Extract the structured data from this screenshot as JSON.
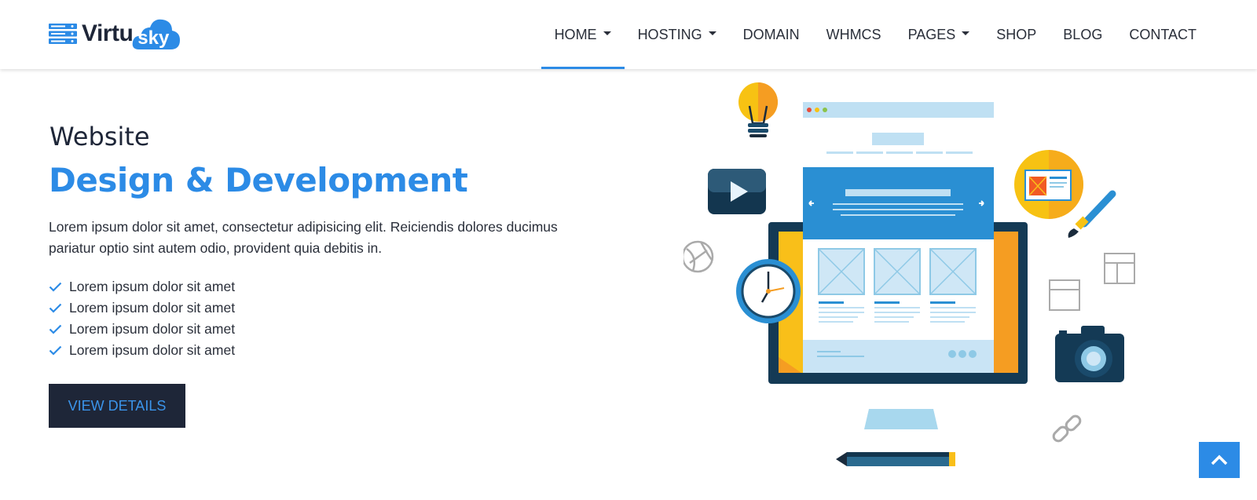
{
  "brand": {
    "name_prefix": "Virtu",
    "name_suffix": "sky",
    "accent_color": "#2c8be6",
    "dark_color": "#1e2638"
  },
  "nav": {
    "items": [
      {
        "label": "HOME",
        "has_dropdown": true,
        "active": true
      },
      {
        "label": "HOSTING",
        "has_dropdown": true,
        "active": false
      },
      {
        "label": "DOMAIN",
        "has_dropdown": false,
        "active": false
      },
      {
        "label": "WHMCS",
        "has_dropdown": false,
        "active": false
      },
      {
        "label": "PAGES",
        "has_dropdown": true,
        "active": false
      },
      {
        "label": "SHOP",
        "has_dropdown": false,
        "active": false
      },
      {
        "label": "BLOG",
        "has_dropdown": false,
        "active": false
      },
      {
        "label": "CONTACT",
        "has_dropdown": false,
        "active": false
      }
    ]
  },
  "hero": {
    "subtitle": "Website",
    "title": "Design & Development",
    "description": "Lorem ipsum dolor sit amet, consectetur adipisicing elit. Reiciendis dolores ducimus pariatur optio sint autem odio, provident quia debitis in.",
    "checklist": [
      "Lorem ipsum dolor sit amet",
      "Lorem ipsum dolor sit amet",
      "Lorem ipsum dolor sit amet",
      "Lorem ipsum dolor sit amet"
    ],
    "button_label": "VIEW DETAILS"
  },
  "icons": {
    "logo": "server-stack-icon",
    "check": "check-icon",
    "scroll_top": "chevron-up-icon",
    "illustration": [
      "lightbulb-icon",
      "video-play-icon",
      "globe-icon",
      "clock-icon",
      "paintbrush-icon",
      "camera-icon",
      "link-icon",
      "window-icon",
      "pencil-icon"
    ]
  }
}
